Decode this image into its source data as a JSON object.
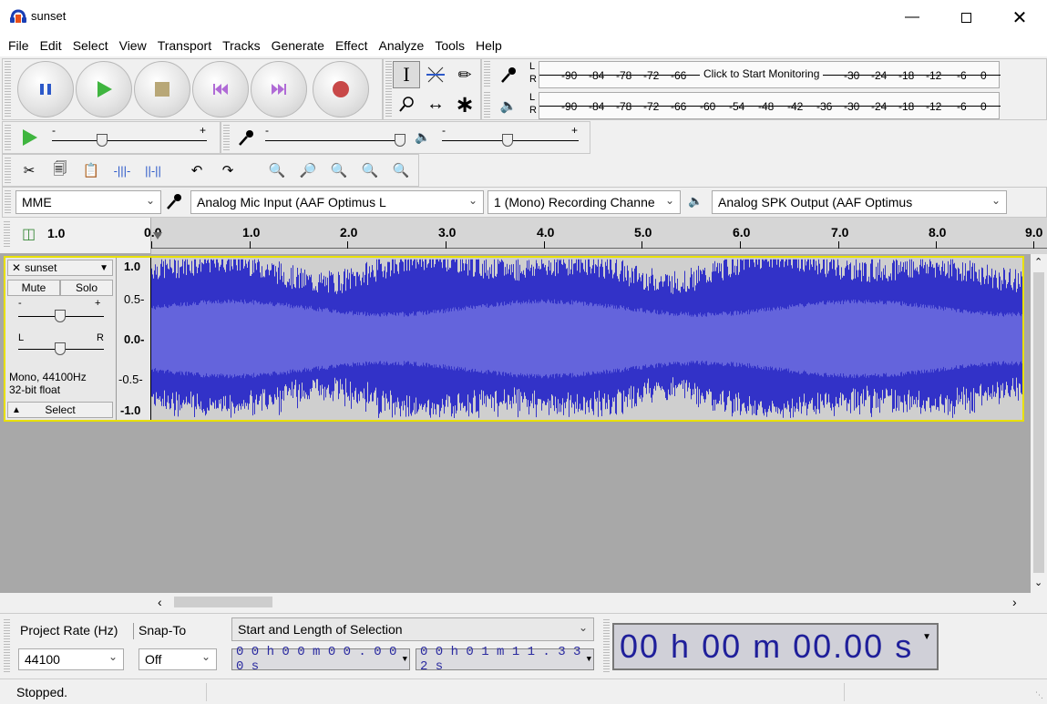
{
  "window": {
    "title": "sunset"
  },
  "menu": [
    "File",
    "Edit",
    "Select",
    "View",
    "Transport",
    "Tracks",
    "Generate",
    "Effect",
    "Analyze",
    "Tools",
    "Help"
  ],
  "meter": {
    "record_scale": [
      "-90",
      "-84",
      "-78",
      "-72",
      "-66",
      "-30",
      "-24",
      "-18",
      "-12",
      "-6",
      "0"
    ],
    "monitor_label": "Click to Start Monitoring",
    "play_scale": [
      "-90",
      "-84",
      "-78",
      "-72",
      "-66",
      "-60",
      "-54",
      "-48",
      "-42",
      "-36",
      "-30",
      "-24",
      "-18",
      "-12",
      "-6",
      "0"
    ],
    "L": "L",
    "R": "R"
  },
  "sliders": {
    "minus": "-",
    "plus": "+"
  },
  "device": {
    "host": "MME",
    "input": "Analog Mic Input (AAF Optimus L",
    "channels": "1 (Mono) Recording Channe",
    "output": "Analog SPK Output (AAF Optimus"
  },
  "timeline": {
    "left_value": "1.0",
    "ticks": [
      "0.0",
      "1.0",
      "2.0",
      "3.0",
      "4.0",
      "5.0",
      "6.0",
      "7.0",
      "8.0",
      "9.0"
    ]
  },
  "track": {
    "name": "sunset",
    "mute": "Mute",
    "solo": "Solo",
    "gain_minus": "-",
    "gain_plus": "+",
    "pan_left": "L",
    "pan_right": "R",
    "info_line1": "Mono, 44100Hz",
    "info_line2": "32-bit float",
    "select": "Select",
    "scale": [
      "1.0",
      "0.5-",
      "0.0-",
      "-0.5-",
      "-1.0"
    ]
  },
  "selection": {
    "project_rate_label": "Project Rate (Hz)",
    "snap_to_label": "Snap-To",
    "mode": "Start and Length of Selection",
    "rate_value": "44100",
    "snap_value": "Off",
    "start_time": "0 0 h 0 0 m 0 0 . 0 0 0 s",
    "length_time": "0 0 h 0 1 m 1 1 . 3 3 2 s",
    "big_time": "00 h 00 m 00.00 s"
  },
  "status": {
    "text": "Stopped."
  },
  "colors": {
    "wave_dark": "#3232c8",
    "wave_light": "#6464dc",
    "track_border": "#e8e000",
    "time_text": "#1f1f9a"
  }
}
